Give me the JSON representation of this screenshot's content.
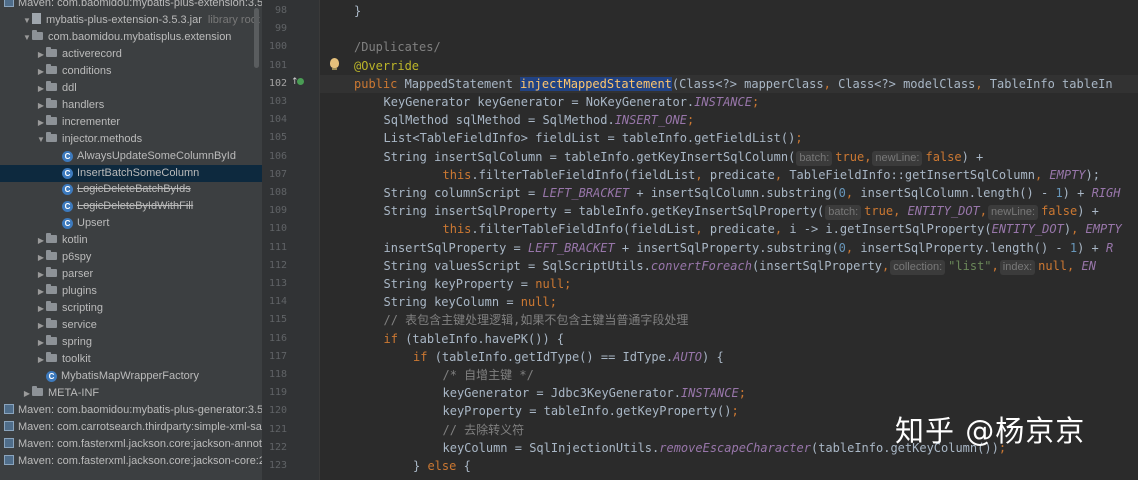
{
  "project_tree": {
    "items": [
      {
        "label": "Maven: com.baomidou:mybatis-plus-extension:3.5.3",
        "kind": "maven",
        "indent": 0,
        "arrow": ""
      },
      {
        "label": "mybatis-plus-extension-3.5.3.jar",
        "extra": "library root",
        "kind": "jar",
        "indent": 1,
        "arrow": "▼"
      },
      {
        "label": "com.baomidou.mybatisplus.extension",
        "kind": "folder",
        "indent": 2,
        "arrow": "▼"
      },
      {
        "label": "activerecord",
        "kind": "folder",
        "indent": 3,
        "arrow": "▶"
      },
      {
        "label": "conditions",
        "kind": "folder",
        "indent": 3,
        "arrow": "▶"
      },
      {
        "label": "ddl",
        "kind": "folder",
        "indent": 3,
        "arrow": "▶"
      },
      {
        "label": "handlers",
        "kind": "folder",
        "indent": 3,
        "arrow": "▶"
      },
      {
        "label": "incrementer",
        "kind": "folder",
        "indent": 3,
        "arrow": "▶"
      },
      {
        "label": "injector.methods",
        "kind": "folder",
        "indent": 3,
        "arrow": "▼"
      },
      {
        "label": "AlwaysUpdateSomeColumnById",
        "kind": "class",
        "indent": 4,
        "arrow": ""
      },
      {
        "label": "InsertBatchSomeColumn",
        "kind": "class",
        "indent": 4,
        "arrow": "",
        "selected": true
      },
      {
        "label": "LogicDeleteBatchByIds",
        "kind": "class",
        "indent": 4,
        "arrow": "",
        "strike": true
      },
      {
        "label": "LogicDeleteByIdWithFill",
        "kind": "class",
        "indent": 4,
        "arrow": "",
        "strike": true
      },
      {
        "label": "Upsert",
        "kind": "class",
        "indent": 4,
        "arrow": ""
      },
      {
        "label": "kotlin",
        "kind": "folder",
        "indent": 3,
        "arrow": "▶"
      },
      {
        "label": "p6spy",
        "kind": "folder",
        "indent": 3,
        "arrow": "▶"
      },
      {
        "label": "parser",
        "kind": "folder",
        "indent": 3,
        "arrow": "▶"
      },
      {
        "label": "plugins",
        "kind": "folder",
        "indent": 3,
        "arrow": "▶"
      },
      {
        "label": "scripting",
        "kind": "folder",
        "indent": 3,
        "arrow": "▶"
      },
      {
        "label": "service",
        "kind": "folder",
        "indent": 3,
        "arrow": "▶"
      },
      {
        "label": "spring",
        "kind": "folder",
        "indent": 3,
        "arrow": "▶"
      },
      {
        "label": "toolkit",
        "kind": "folder",
        "indent": 3,
        "arrow": "▶"
      },
      {
        "label": "MybatisMapWrapperFactory",
        "kind": "class",
        "indent": 3,
        "arrow": ""
      },
      {
        "label": "META-INF",
        "kind": "folder",
        "indent": 2,
        "arrow": "▶"
      },
      {
        "label": "Maven: com.baomidou:mybatis-plus-generator:3.5.2",
        "kind": "maven",
        "indent": 0,
        "arrow": ""
      },
      {
        "label": "Maven: com.carrotsearch.thirdparty:simple-xml-safe:2",
        "kind": "maven",
        "indent": 0,
        "arrow": ""
      },
      {
        "label": "Maven: com.fasterxml.jackson.core:jackson-annotatio",
        "kind": "maven",
        "indent": 0,
        "arrow": ""
      },
      {
        "label": "Maven: com.fasterxml.jackson.core:jackson-core:2.14.",
        "kind": "maven",
        "indent": 0,
        "arrow": ""
      }
    ]
  },
  "editor": {
    "current_line": 102,
    "lines": [
      {
        "n": 98,
        "indent": 0,
        "t": [
          [
            "}",
            ""
          ]
        ]
      },
      {
        "n": 99,
        "indent": 0,
        "t": []
      },
      {
        "n": 100,
        "indent": 0,
        "t": [
          [
            "/Duplicates/",
            "cm"
          ]
        ]
      },
      {
        "n": 101,
        "indent": 0,
        "t": [
          [
            "@Override",
            "ann"
          ]
        ]
      },
      {
        "n": 102,
        "indent": 0,
        "t": [
          [
            "public ",
            "kw"
          ],
          [
            "MappedStatement ",
            ""
          ],
          [
            "injectMappedStatement",
            "fn sel-word"
          ],
          [
            "(Class<?> mapperClass",
            ""
          ],
          [
            ", ",
            "kw"
          ],
          [
            "Class<?> modelClass",
            ""
          ],
          [
            ", ",
            "kw"
          ],
          [
            "TableInfo tableIn",
            ""
          ]
        ]
      },
      {
        "n": 103,
        "indent": 1,
        "t": [
          [
            "KeyGenerator keyGenerator = NoKeyGenerator.",
            ""
          ],
          [
            "INSTANCE",
            "st"
          ],
          [
            ";",
            "kw"
          ]
        ]
      },
      {
        "n": 104,
        "indent": 1,
        "t": [
          [
            "SqlMethod sqlMethod = SqlMethod.",
            ""
          ],
          [
            "INSERT_ONE",
            "st"
          ],
          [
            ";",
            "kw"
          ]
        ]
      },
      {
        "n": 105,
        "indent": 1,
        "t": [
          [
            "List<TableFieldInfo> fieldList = tableInfo.getFieldList()",
            ""
          ],
          [
            ";",
            "kw"
          ]
        ]
      },
      {
        "n": 106,
        "indent": 1,
        "t": [
          [
            "String insertSqlColumn = tableInfo.getKeyInsertSqlColumn(",
            ""
          ],
          [
            "batch:",
            "hint"
          ],
          [
            "true",
            "kw"
          ],
          [
            ",",
            "kw"
          ],
          [
            "newLine:",
            "hint"
          ],
          [
            "false",
            "kw"
          ],
          [
            ") +",
            ""
          ]
        ]
      },
      {
        "n": 107,
        "indent": 3,
        "t": [
          [
            "this",
            "kw"
          ],
          [
            ".filterTableFieldInfo(fieldList",
            ""
          ],
          [
            ", ",
            "kw"
          ],
          [
            "predicate",
            ""
          ],
          [
            ", ",
            "kw"
          ],
          [
            "TableFieldInfo::getInsertSqlColumn",
            ""
          ],
          [
            ", ",
            "kw"
          ],
          [
            "EMPTY",
            "st"
          ],
          [
            ");",
            ""
          ]
        ]
      },
      {
        "n": 108,
        "indent": 1,
        "t": [
          [
            "String columnScript = ",
            ""
          ],
          [
            "LEFT_BRACKET",
            "st"
          ],
          [
            " + insertSqlColumn.substring(",
            ""
          ],
          [
            "0",
            "num"
          ],
          [
            ", ",
            "kw"
          ],
          [
            "insertSqlColumn.length() - ",
            ""
          ],
          [
            "1",
            "num"
          ],
          [
            ") + ",
            ""
          ],
          [
            "RIGH",
            "st"
          ]
        ]
      },
      {
        "n": 109,
        "indent": 1,
        "t": [
          [
            "String insertSqlProperty = tableInfo.getKeyInsertSqlProperty(",
            ""
          ],
          [
            "batch:",
            "hint"
          ],
          [
            "true",
            "kw"
          ],
          [
            ", ",
            "kw"
          ],
          [
            "ENTITY_DOT",
            "st"
          ],
          [
            ",",
            "kw"
          ],
          [
            "newLine:",
            "hint"
          ],
          [
            "false",
            "kw"
          ],
          [
            ") +",
            ""
          ]
        ]
      },
      {
        "n": 110,
        "indent": 3,
        "t": [
          [
            "this",
            "kw"
          ],
          [
            ".filterTableFieldInfo(fieldList",
            ""
          ],
          [
            ", ",
            "kw"
          ],
          [
            "predicate",
            ""
          ],
          [
            ", ",
            "kw"
          ],
          [
            "i -> i.getInsertSqlProperty(",
            ""
          ],
          [
            "ENTITY_DOT",
            "st"
          ],
          [
            ")",
            ""
          ],
          [
            ", ",
            "kw"
          ],
          [
            "EMPTY",
            "st"
          ]
        ]
      },
      {
        "n": 111,
        "indent": 1,
        "t": [
          [
            "insertSqlProperty = ",
            ""
          ],
          [
            "LEFT_BRACKET",
            "st"
          ],
          [
            " + insertSqlProperty.substring(",
            ""
          ],
          [
            "0",
            "num"
          ],
          [
            ", ",
            "kw"
          ],
          [
            "insertSqlProperty.length() - ",
            ""
          ],
          [
            "1",
            "num"
          ],
          [
            ") + ",
            ""
          ],
          [
            "R",
            "st"
          ]
        ]
      },
      {
        "n": 112,
        "indent": 1,
        "t": [
          [
            "String valuesScript = SqlScriptUtils.",
            ""
          ],
          [
            "convertForeach",
            "st"
          ],
          [
            "(insertSqlProperty",
            ""
          ],
          [
            ",",
            "kw"
          ],
          [
            "collection:",
            "hint"
          ],
          [
            "\"list\"",
            "str"
          ],
          [
            ",",
            "kw"
          ],
          [
            "index:",
            "hint"
          ],
          [
            "null",
            "kw"
          ],
          [
            ", ",
            "kw"
          ],
          [
            "EN",
            "st"
          ]
        ]
      },
      {
        "n": 113,
        "indent": 1,
        "t": [
          [
            "String keyProperty = ",
            ""
          ],
          [
            "null",
            "kw"
          ],
          [
            ";",
            "kw"
          ]
        ]
      },
      {
        "n": 114,
        "indent": 1,
        "t": [
          [
            "String keyColumn = ",
            ""
          ],
          [
            "null",
            "kw"
          ],
          [
            ";",
            "kw"
          ]
        ]
      },
      {
        "n": 115,
        "indent": 1,
        "t": [
          [
            "// 表包含主键处理逻辑,如果不包含主键当普通字段处理",
            "cm"
          ]
        ]
      },
      {
        "n": 116,
        "indent": 1,
        "t": [
          [
            "if ",
            "kw"
          ],
          [
            "(tableInfo.havePK()) {",
            ""
          ]
        ]
      },
      {
        "n": 117,
        "indent": 2,
        "t": [
          [
            "if ",
            "kw"
          ],
          [
            "(tableInfo.getIdType() == IdType.",
            ""
          ],
          [
            "AUTO",
            "st"
          ],
          [
            ") {",
            ""
          ]
        ]
      },
      {
        "n": 118,
        "indent": 3,
        "t": [
          [
            "/* 自增主键 */",
            "cm"
          ]
        ]
      },
      {
        "n": 119,
        "indent": 3,
        "t": [
          [
            "keyGenerator = Jdbc3KeyGenerator.",
            ""
          ],
          [
            "INSTANCE",
            "st"
          ],
          [
            ";",
            "kw"
          ]
        ]
      },
      {
        "n": 120,
        "indent": 3,
        "t": [
          [
            "keyProperty = tableInfo.getKeyProperty()",
            ""
          ],
          [
            ";",
            "kw"
          ]
        ]
      },
      {
        "n": 121,
        "indent": 3,
        "t": [
          [
            "// 去除转义符",
            "cm"
          ]
        ]
      },
      {
        "n": 122,
        "indent": 3,
        "t": [
          [
            "keyColumn = SqlInjectionUtils.",
            ""
          ],
          [
            "removeEscapeCharacter",
            "st"
          ],
          [
            "(tableInfo.getKeyColumn())",
            ""
          ],
          [
            ";",
            "kw"
          ]
        ]
      },
      {
        "n": 123,
        "indent": 2,
        "t": [
          [
            "} ",
            ""
          ],
          [
            "else ",
            "kw"
          ],
          [
            "{",
            ""
          ]
        ]
      }
    ]
  },
  "watermark": "知乎 @杨京京"
}
